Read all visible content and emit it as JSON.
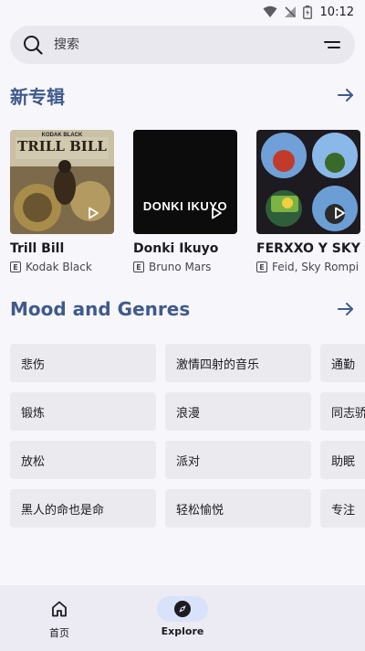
{
  "status": {
    "time": "10:12"
  },
  "search": {
    "placeholder": "搜索"
  },
  "new_albums": {
    "title": "新专辑",
    "items": [
      {
        "title": "Trill Bill",
        "artist": "Kodak Black",
        "explicit": "E",
        "cover_text": "TRILL BILL",
        "cover_small": "KODAK BLACK"
      },
      {
        "title": "Donki Ikuyo",
        "artist": "Bruno Mars",
        "explicit": "E",
        "cover_text": "DONKI IKUYO"
      },
      {
        "title": "FERXXO Y SKY R",
        "artist": "Feid, Sky Rompi",
        "explicit": "E"
      }
    ]
  },
  "genres": {
    "title": "Mood and Genres",
    "items": [
      "悲伤",
      "激情四射的音乐",
      "通勤",
      "锻炼",
      "浪漫",
      "同志骄",
      "放松",
      "派对",
      "助眠",
      "黑人的命也是命",
      "轻松愉悦",
      "专注"
    ]
  },
  "nav": {
    "items": [
      {
        "label": "首页",
        "icon": "home-icon",
        "active": false
      },
      {
        "label": "Explore",
        "icon": "explore-icon",
        "active": true
      }
    ]
  },
  "colors": {
    "accent": "#3f5a8c",
    "chip": "#eaeaef",
    "background": "#f7f6fb"
  }
}
